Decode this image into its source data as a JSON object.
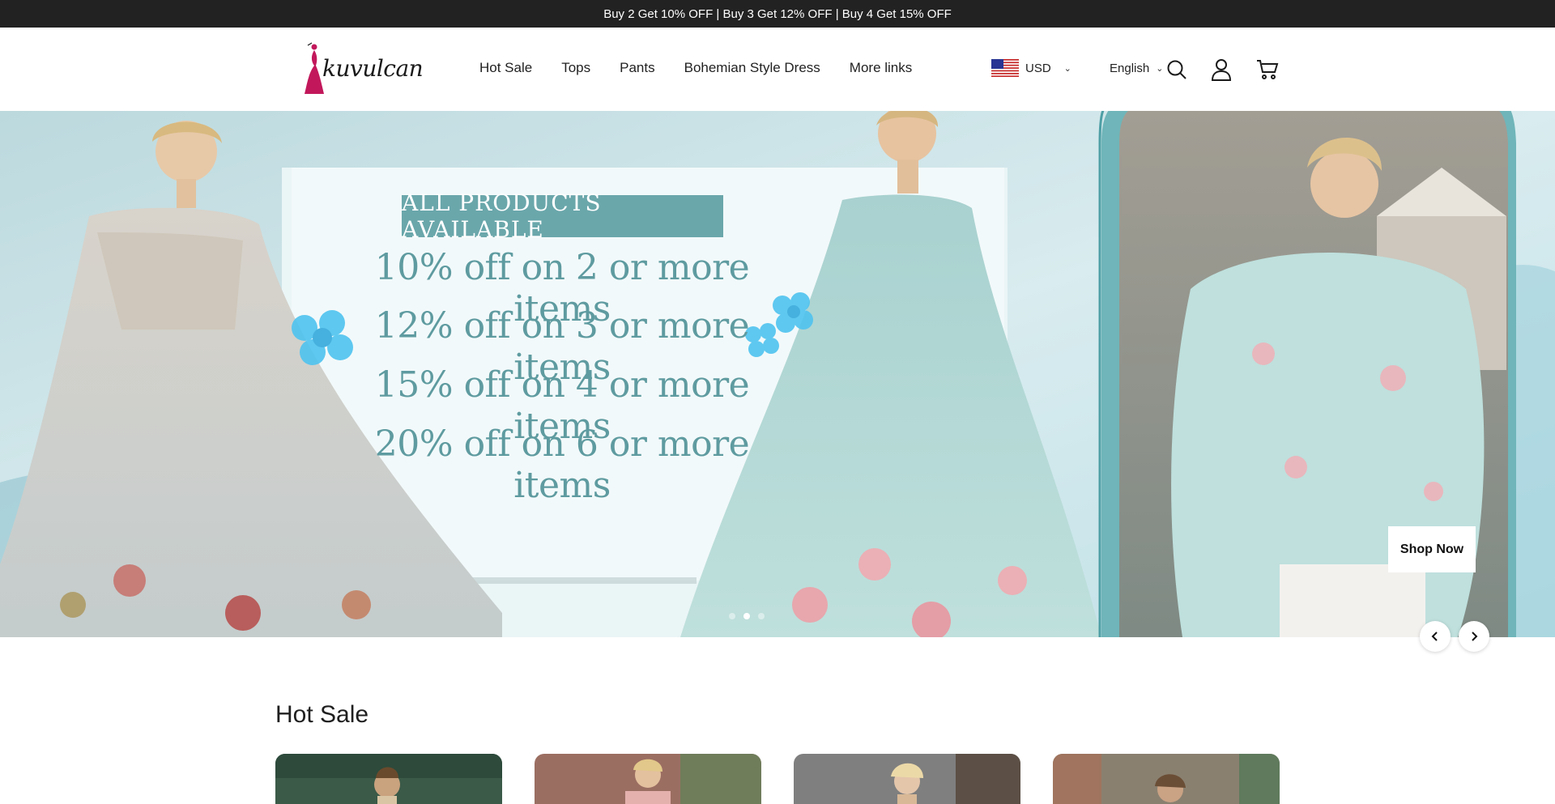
{
  "announcement": "Buy 2 Get 10% OFF | Buy 3 Get 12% OFF | Buy 4 Get 15% OFF",
  "header": {
    "logo_text": "kuvulcan",
    "nav": [
      "Hot Sale",
      "Tops",
      "Pants",
      "Bohemian Style Dress",
      "More links"
    ],
    "currency": "USD",
    "language": "English",
    "icons": [
      "search-icon",
      "account-icon",
      "cart-icon"
    ]
  },
  "hero": {
    "promo_title": "ALL PRODUCTS AVAILABLE",
    "promo_lines": [
      "10% off on 2 or more items",
      "12% off on 3 or more items",
      "15% off on 4 or more items",
      "20% off on 6 or more items"
    ],
    "cta": "Shop Now",
    "slide_count": 3,
    "active_slide": 2
  },
  "hot_sale": {
    "title": "Hot Sale",
    "card_count": 4
  },
  "colors": {
    "announcement_bg": "#222222",
    "promo_teal": "#6aa7ab",
    "promo_text": "#5e9ba0",
    "hero_bg": "#cfe6ea"
  }
}
